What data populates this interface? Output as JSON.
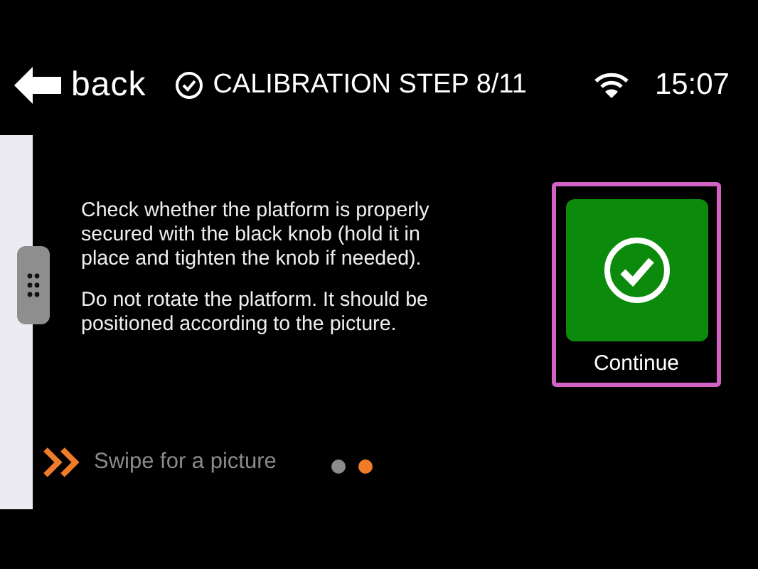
{
  "header": {
    "back_label": "back",
    "title": "CALIBRATION STEP 8/11",
    "time": "15:07"
  },
  "instructions": [
    "Check whether the platform is properly secured with the black knob (hold it in place and tighten the knob if needed).",
    "Do not rotate the platform. It should be positioned according to the picture."
  ],
  "continue_button": {
    "label": "Continue",
    "focused": true
  },
  "swipe_hint": "Swipe for a picture",
  "pages": [
    {
      "selected": false
    },
    {
      "selected": true
    }
  ]
}
